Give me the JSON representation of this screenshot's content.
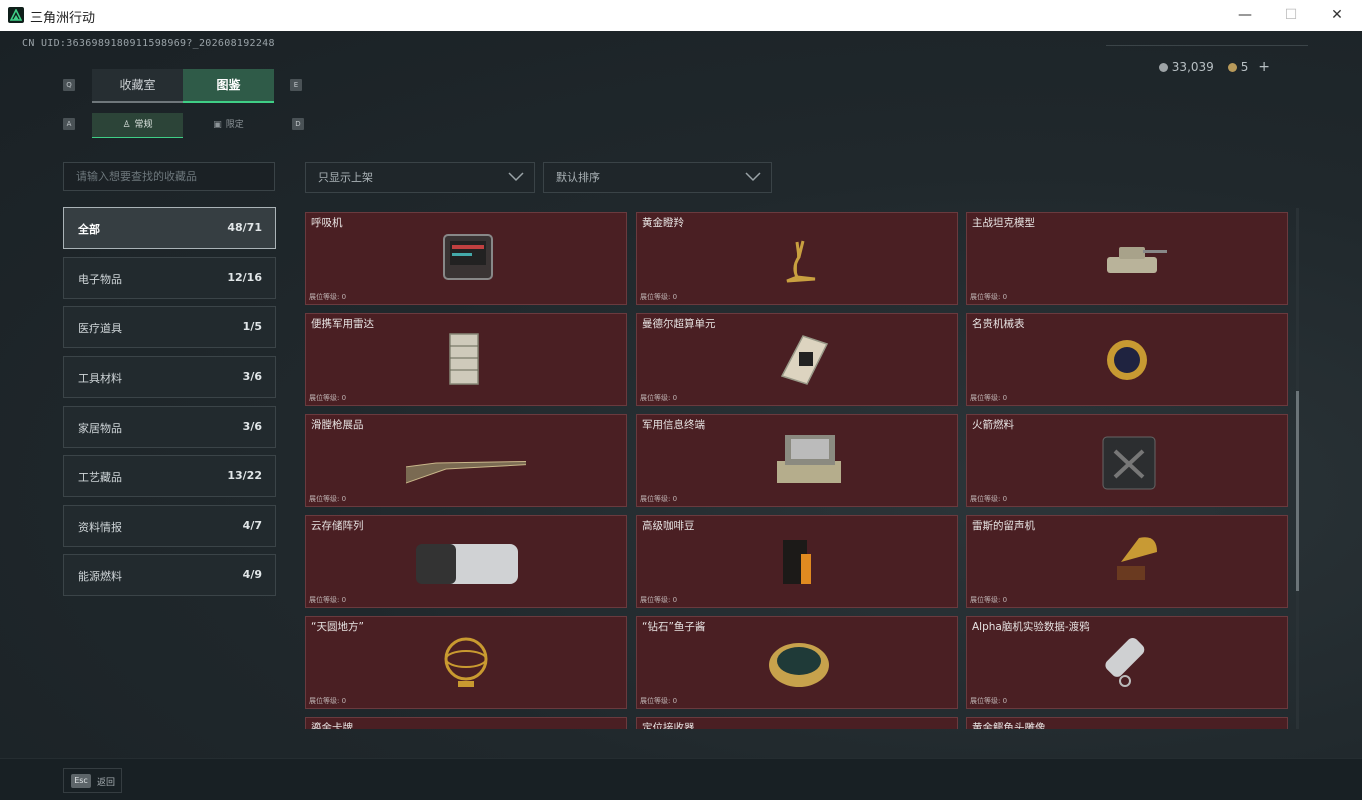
{
  "window": {
    "title": "三角洲行动",
    "min": "—",
    "max": "☐",
    "close": "✕"
  },
  "header": {
    "uid": "CN UID:3636989180911598969?_202608192248",
    "silver": "33,039",
    "gold": "5",
    "plus": "+"
  },
  "keys": {
    "q": "Q",
    "e": "E",
    "a": "A",
    "d": "D"
  },
  "tabs": [
    {
      "label": "收藏室"
    },
    {
      "label": "图鉴"
    }
  ],
  "subtabs": [
    {
      "label": "常规"
    },
    {
      "label": "限定"
    }
  ],
  "search": {
    "placeholder": "请输入想要查找的收藏品"
  },
  "filters": {
    "shelf": "只显示上架",
    "sort": "默认排序"
  },
  "categories": [
    {
      "label": "全部",
      "count": "48/71"
    },
    {
      "label": "电子物品",
      "count": "12/16"
    },
    {
      "label": "医疗道具",
      "count": "1/5"
    },
    {
      "label": "工具材料",
      "count": "3/6"
    },
    {
      "label": "家居物品",
      "count": "3/6"
    },
    {
      "label": "工艺藏品",
      "count": "13/22"
    },
    {
      "label": "资料情报",
      "count": "4/7"
    },
    {
      "label": "能源燃料",
      "count": "4/9"
    }
  ],
  "items": [
    {
      "name": "呼吸机",
      "level": "展位等级: 0",
      "icon": "ventilator-icon"
    },
    {
      "name": "黄金瞪羚",
      "level": "展位等级: 0",
      "icon": "golden-gazelle-icon"
    },
    {
      "name": "主战坦克模型",
      "level": "展位等级: 0",
      "icon": "tank-model-icon"
    },
    {
      "name": "便携军用雷达",
      "level": "展位等级: 0",
      "icon": "radar-icon"
    },
    {
      "name": "曼德尔超算单元",
      "level": "展位等级: 0",
      "icon": "supercomputer-unit-icon"
    },
    {
      "name": "名贵机械表",
      "level": "展位等级: 0",
      "icon": "watch-icon"
    },
    {
      "name": "滑膛枪展品",
      "level": "展位等级: 0",
      "icon": "musket-icon"
    },
    {
      "name": "军用信息终端",
      "level": "展位等级: 0",
      "icon": "military-terminal-icon"
    },
    {
      "name": "火箭燃料",
      "level": "展位等级: 0",
      "icon": "fuel-can-icon"
    },
    {
      "name": "云存储阵列",
      "level": "展位等级: 0",
      "icon": "storage-array-icon"
    },
    {
      "name": "高级咖啡豆",
      "level": "展位等级: 0",
      "icon": "coffee-bag-icon"
    },
    {
      "name": "雷斯的留声机",
      "level": "展位等级: 0",
      "icon": "gramophone-icon"
    },
    {
      "name": "“天圆地方”",
      "level": "展位等级: 0",
      "icon": "armillary-sphere-icon"
    },
    {
      "name": "“钻石”鱼子酱",
      "level": "展位等级: 0",
      "icon": "caviar-tin-icon"
    },
    {
      "name": "Alpha脑机实验数据-渡鸦",
      "level": "展位等级: 0",
      "icon": "data-drive-icon"
    },
    {
      "name": "鎏金卡牌",
      "level": "",
      "icon": "gold-card-icon"
    },
    {
      "name": "定位接收器",
      "level": "",
      "icon": "receiver-icon"
    },
    {
      "name": "黄金鳄鱼头雕像",
      "level": "",
      "icon": "croc-statue-icon"
    }
  ],
  "footer": {
    "key": "Esc",
    "label": "返回"
  },
  "colors": {
    "accent": "#3fcf86",
    "card_bg": "#4a1f23",
    "card_border": "#6a3a3e"
  }
}
